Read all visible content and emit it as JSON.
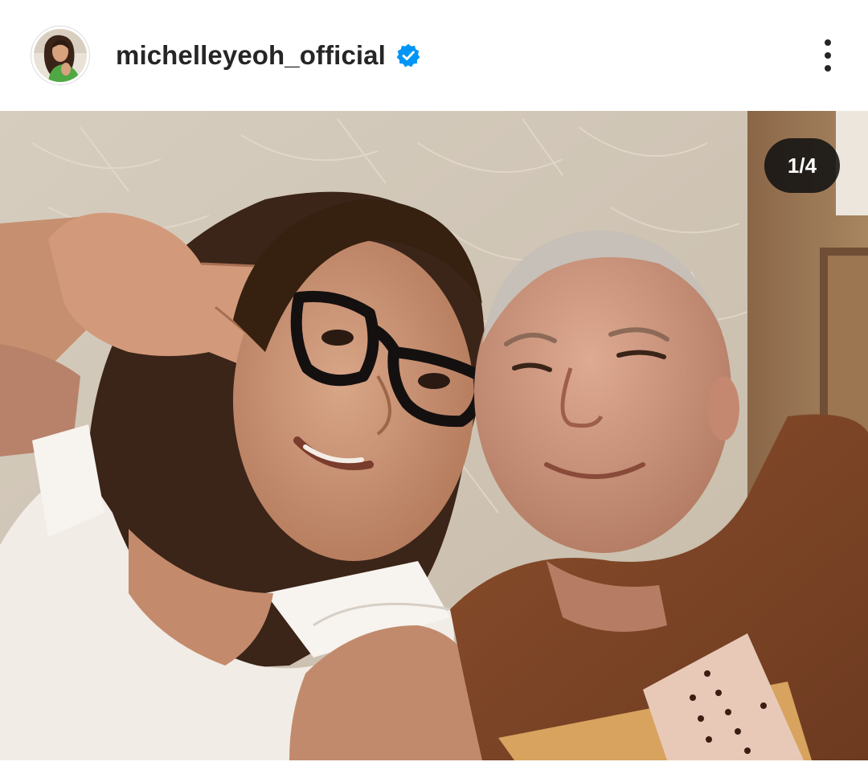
{
  "post": {
    "username": "michelleyeoh_official",
    "verified": true,
    "avatar_icon": "profile-photo",
    "more_icon": "more-vertical-icon"
  },
  "carousel": {
    "counter": "1/4"
  },
  "colors": {
    "username_text": "#262626",
    "verified_badge": "#0095f6",
    "counter_background": "#121212"
  }
}
